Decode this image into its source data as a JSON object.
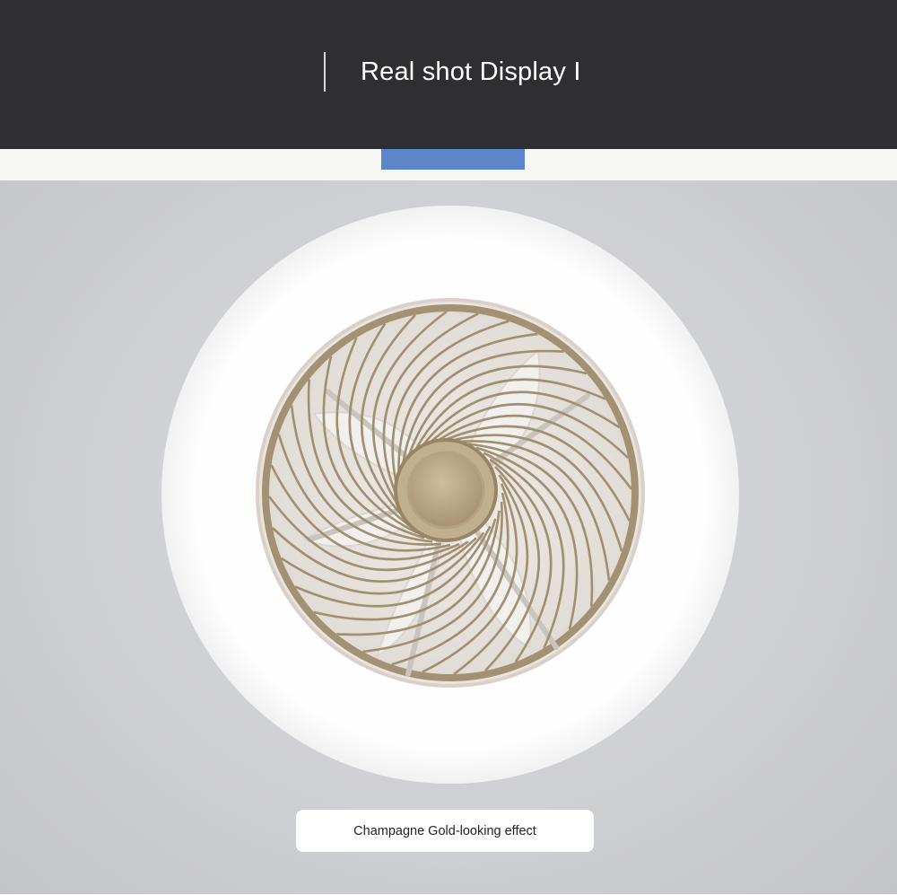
{
  "header": {
    "title": "Real shot Display I",
    "background_color": "#2f2e33",
    "accent_color": "#5b86c9"
  },
  "photo": {
    "subject_icon": "ceiling-fan-light",
    "cage_color": "#9a8a70",
    "ring_color": "#ffffff",
    "ceiling_color": "#cfd0d4"
  },
  "caption": {
    "text": "Champagne Gold-looking effect"
  }
}
